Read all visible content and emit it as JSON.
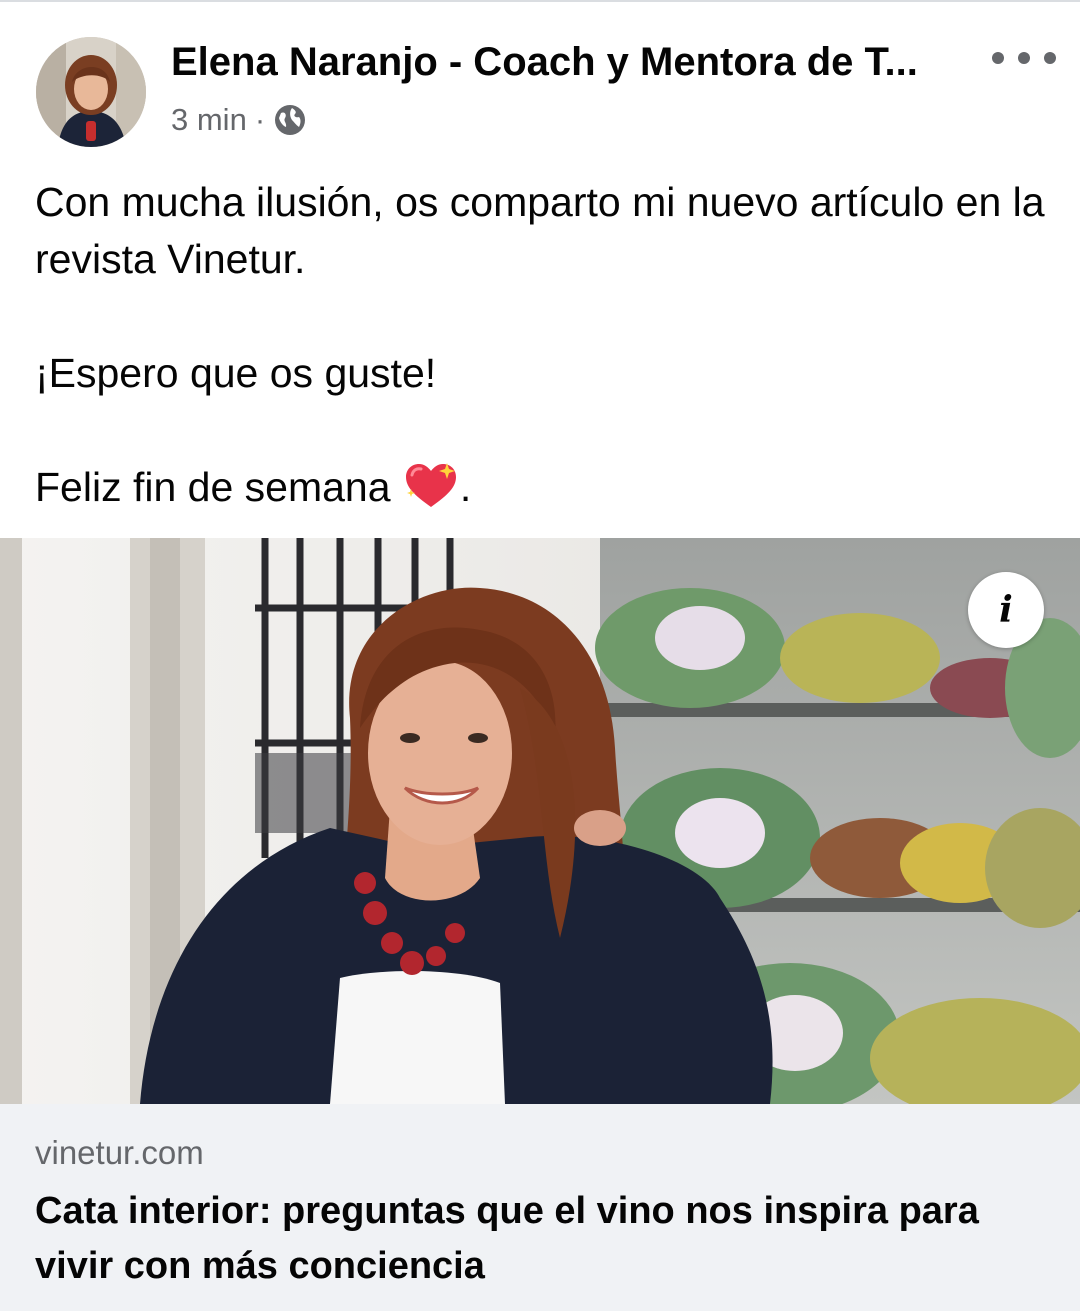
{
  "post": {
    "author_name": "Elena Naranjo - Coach y Mentora de T...",
    "timestamp": "3 min",
    "separator": "·",
    "audience_icon": "globe-icon",
    "more_icon": "more-dots-icon",
    "text": {
      "line1": "Con mucha ilusión, os comparto mi nuevo artículo en la revista Vinetur.",
      "line2": "¡Espero que os guste!",
      "line3_prefix": "Feliz fin de semana ",
      "line3_suffix": ".",
      "emoji_icon": "sparkling-heart-icon"
    }
  },
  "link_preview": {
    "info_label": "i",
    "domain": "vinetur.com",
    "title": "Cata interior: preguntas que el vino nos inspira para vivir con más conciencia"
  },
  "colors": {
    "primary_text": "#050505",
    "secondary_text": "#65676b",
    "link_footer_bg": "#f0f2f5",
    "heart": "#e8334a"
  }
}
